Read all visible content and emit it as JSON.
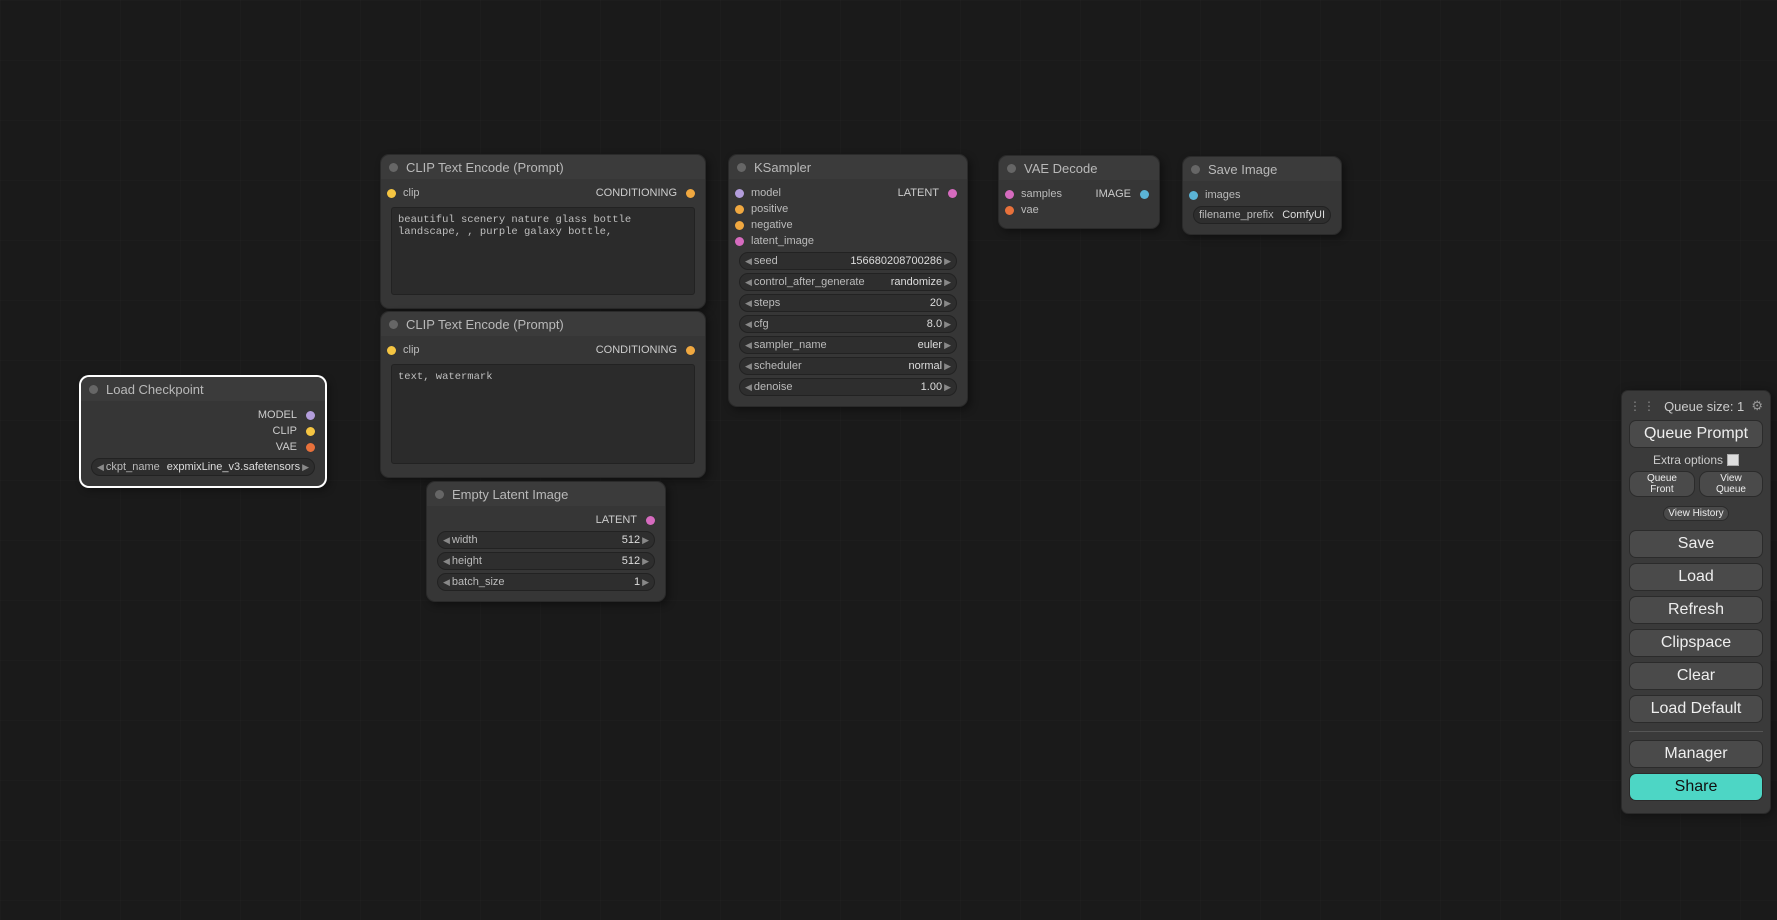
{
  "colors": {
    "model": "#b39ddb",
    "clip": "#f5c542",
    "vae": "#e8713b",
    "conditioning": "#f0a840",
    "latent": "#d66bbf",
    "image": "#5bb4d6",
    "white": "#e0e0e0"
  },
  "nodes": {
    "load_ckpt": {
      "title": "Load Checkpoint",
      "outputs": {
        "model": "MODEL",
        "clip": "CLIP",
        "vae": "VAE"
      },
      "widget": {
        "label": "ckpt_name",
        "value": "expmixLine_v3.safetensors"
      }
    },
    "clip_pos": {
      "title": "CLIP Text Encode (Prompt)",
      "inputs": {
        "clip": "clip"
      },
      "outputs": {
        "cond": "CONDITIONING"
      },
      "text": "beautiful scenery nature glass bottle landscape, , purple galaxy bottle,"
    },
    "clip_neg": {
      "title": "CLIP Text Encode (Prompt)",
      "inputs": {
        "clip": "clip"
      },
      "outputs": {
        "cond": "CONDITIONING"
      },
      "text": "text, watermark"
    },
    "empty_latent": {
      "title": "Empty Latent Image",
      "outputs": {
        "latent": "LATENT"
      },
      "widgets": {
        "width": {
          "label": "width",
          "value": "512"
        },
        "height": {
          "label": "height",
          "value": "512"
        },
        "batch": {
          "label": "batch_size",
          "value": "1"
        }
      }
    },
    "ksampler": {
      "title": "KSampler",
      "inputs": {
        "model": "model",
        "positive": "positive",
        "negative": "negative",
        "latent_image": "latent_image"
      },
      "outputs": {
        "latent": "LATENT"
      },
      "widgets": {
        "seed": {
          "label": "seed",
          "value": "156680208700286"
        },
        "control": {
          "label": "control_after_generate",
          "value": "randomize"
        },
        "steps": {
          "label": "steps",
          "value": "20"
        },
        "cfg": {
          "label": "cfg",
          "value": "8.0"
        },
        "sampler": {
          "label": "sampler_name",
          "value": "euler"
        },
        "scheduler": {
          "label": "scheduler",
          "value": "normal"
        },
        "denoise": {
          "label": "denoise",
          "value": "1.00"
        }
      }
    },
    "vae_decode": {
      "title": "VAE Decode",
      "inputs": {
        "samples": "samples",
        "vae": "vae"
      },
      "outputs": {
        "image": "IMAGE"
      }
    },
    "save_image": {
      "title": "Save Image",
      "inputs": {
        "images": "images"
      },
      "widget": {
        "label": "filename_prefix",
        "value": "ComfyUI"
      }
    }
  },
  "panel": {
    "queue_size": "Queue size: 1",
    "queue_prompt": "Queue Prompt",
    "extra_options": "Extra options",
    "queue_front": "Queue Front",
    "view_queue": "View Queue",
    "view_history": "View History",
    "save": "Save",
    "load": "Load",
    "refresh": "Refresh",
    "clipspace": "Clipspace",
    "clear": "Clear",
    "load_default": "Load Default",
    "manager": "Manager",
    "share": "Share"
  }
}
